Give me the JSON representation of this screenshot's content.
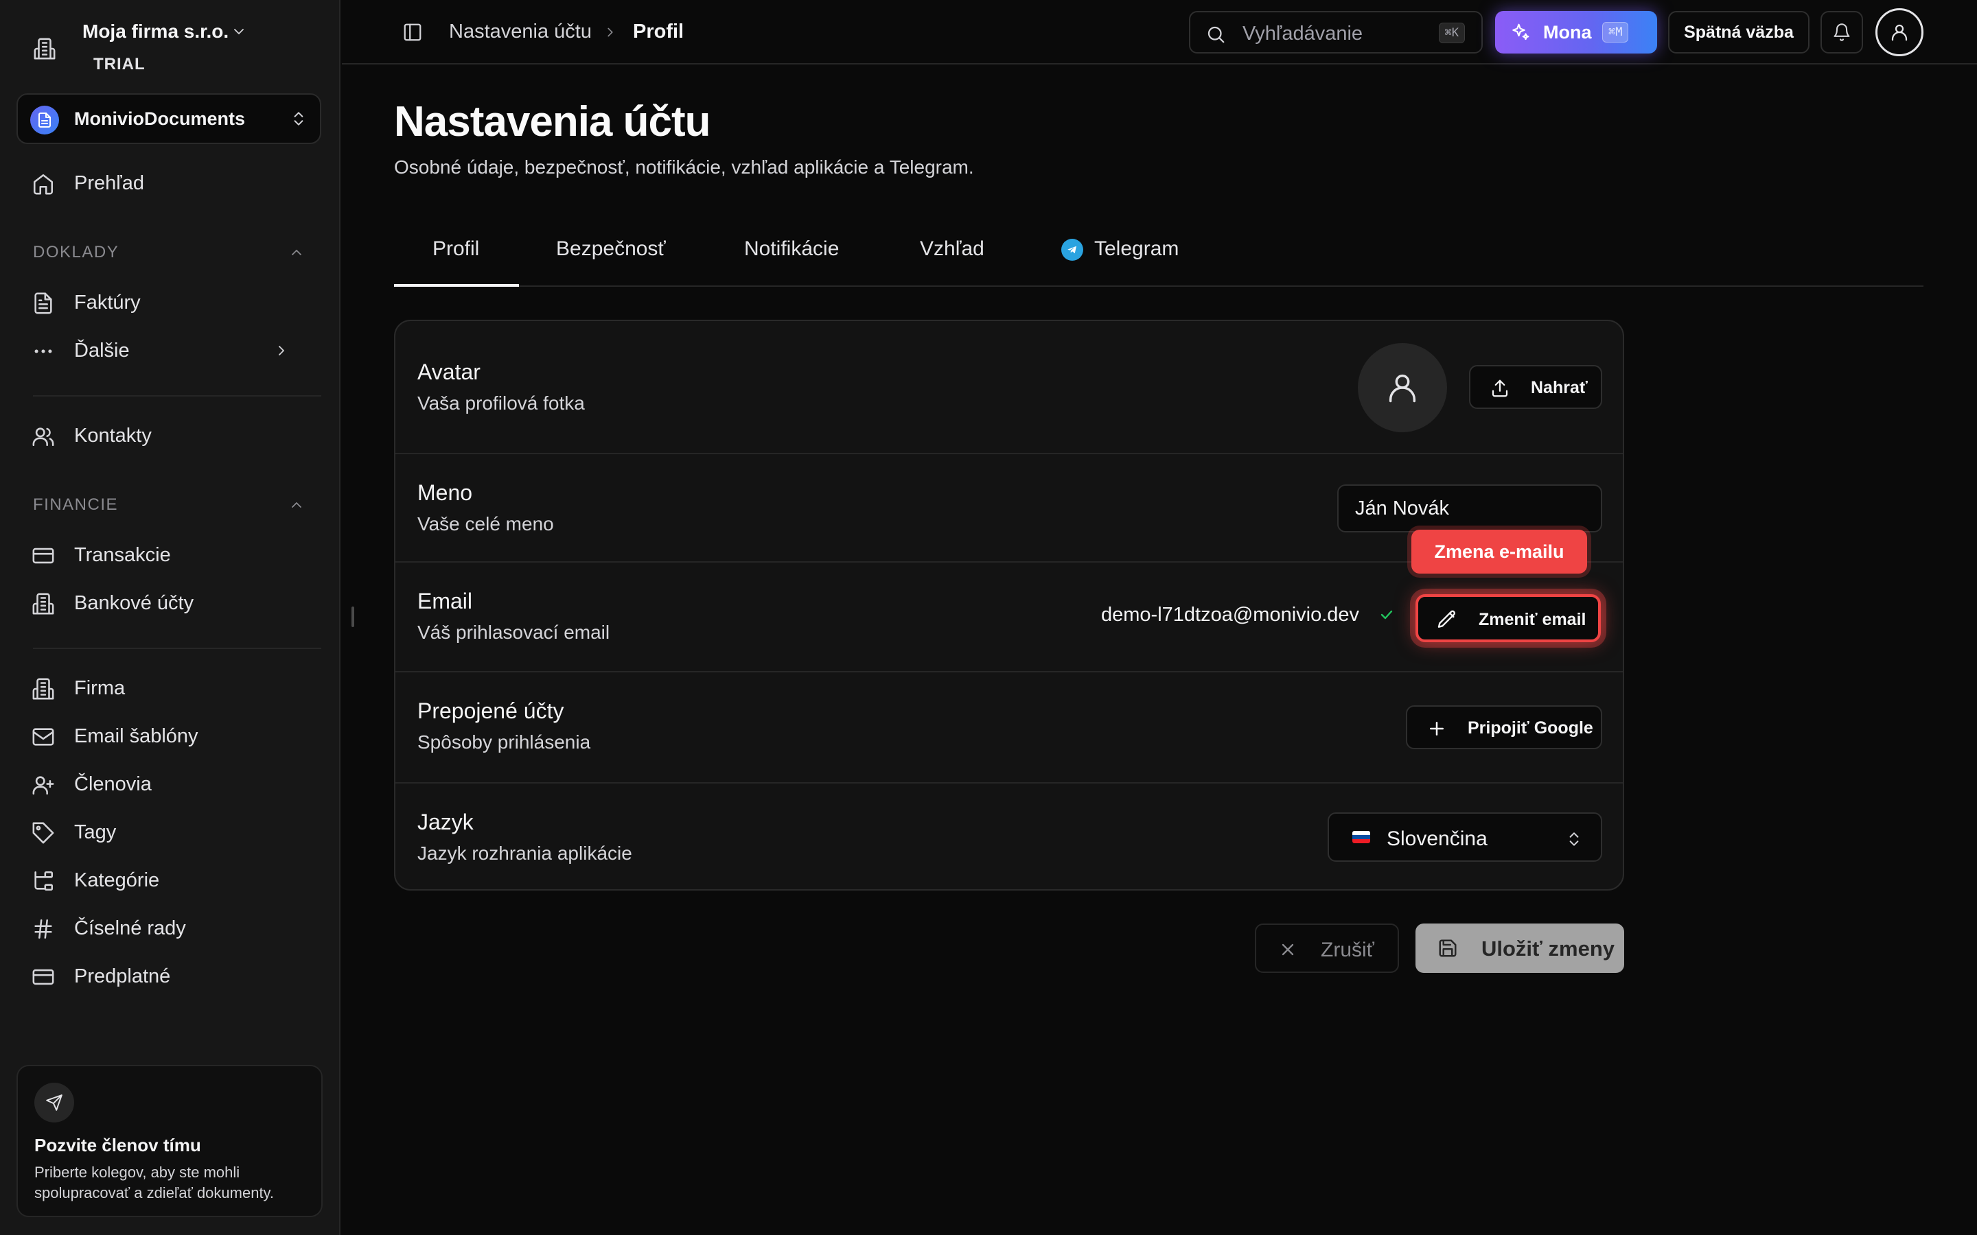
{
  "sidebar": {
    "org_name": "Moja firma s.r.o.",
    "org_badge": "TRIAL",
    "app_name": "MonivioDocuments",
    "overview": "Prehľad",
    "sections": {
      "documents": "DOKLADY",
      "finance": "FINANCIE"
    },
    "items": {
      "invoices": "Faktúry",
      "more": "Ďalšie",
      "contacts": "Kontakty",
      "transactions": "Transakcie",
      "bank_accounts": "Bankové účty",
      "company": "Firma",
      "email_templates": "Email šablóny",
      "members": "Členovia",
      "tags": "Tagy",
      "categories": "Kategórie",
      "number_series": "Číselné rady",
      "subscription": "Predplatné"
    },
    "invite": {
      "title": "Pozvite členov tímu",
      "text": "Priberte kolegov, aby ste mohli spolupracovať a zdieľať dokumenty."
    }
  },
  "topbar": {
    "breadcrumb": [
      "Nastavenia účtu",
      "Profil"
    ],
    "search_placeholder": "Vyhľadávanie",
    "search_shortcut": "⌘K",
    "mona_label": "Mona",
    "mona_shortcut": "⌘M",
    "feedback_label": "Spätná väzba"
  },
  "page": {
    "title": "Nastavenia účtu",
    "subtitle": "Osobné údaje, bezpečnosť, notifikácie, vzhľad aplikácie a Telegram."
  },
  "tabs": [
    "Profil",
    "Bezpečnosť",
    "Notifikácie",
    "Vzhľad",
    "Telegram"
  ],
  "active_tab": "Profil",
  "profile": {
    "avatar": {
      "title": "Avatar",
      "desc": "Vaša profilová fotka",
      "upload_label": "Nahrať"
    },
    "name": {
      "title": "Meno",
      "desc": "Vaše celé meno",
      "value": "Ján Novák"
    },
    "email": {
      "title": "Email",
      "desc": "Váš prihlasovací email",
      "value": "demo-l71dtzoa@monivio.dev",
      "change_label": "Zmeniť email",
      "tooltip": "Zmena e-mailu"
    },
    "linked": {
      "title": "Prepojené účty",
      "desc": "Spôsoby prihlásenia",
      "connect_label": "Pripojiť Google"
    },
    "language": {
      "title": "Jazyk",
      "desc": "Jazyk rozhrania aplikácie",
      "value": "Slovenčina"
    }
  },
  "actions": {
    "cancel": "Zrušiť",
    "save": "Uložiť zmeny"
  },
  "colors": {
    "highlight": "#ef4444",
    "mona_gradient_start": "#8b5cf6",
    "mona_gradient_end": "#3b82f6",
    "verified": "#22c55e",
    "telegram": "#2aa3e0"
  },
  "icons": {
    "org": "building-icon",
    "nav_overview": "home-icon",
    "nav_invoices": "document-icon",
    "nav_contacts": "users-icon",
    "nav_transactions": "credit-card-icon",
    "nav_company": "building-icon",
    "nav_email_templates": "mail-icon",
    "nav_members": "user-plus-icon",
    "nav_tags": "tag-icon",
    "nav_categories": "tree-icon",
    "nav_number_series": "hash-icon",
    "invite": "send-icon"
  }
}
